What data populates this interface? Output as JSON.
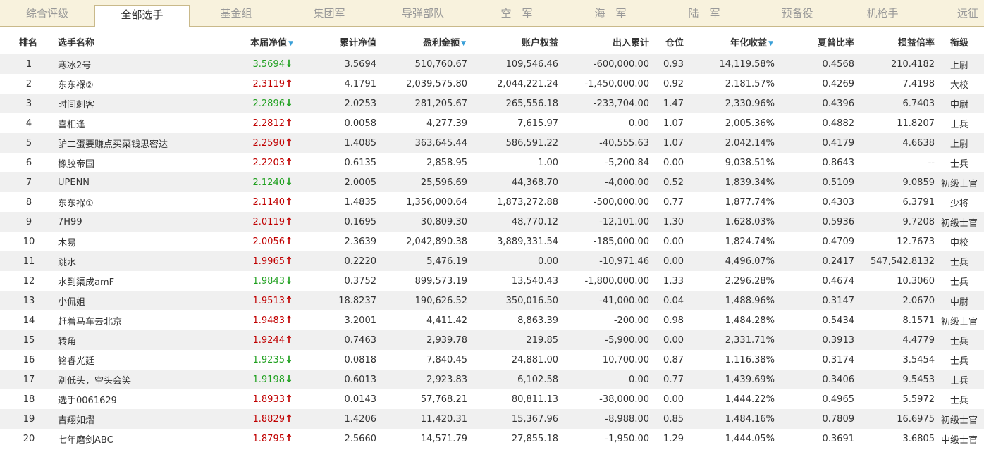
{
  "tabs": [
    {
      "label": "综合评级",
      "active": false
    },
    {
      "label": "全部选手",
      "active": true
    },
    {
      "label": "基金组",
      "active": false
    },
    {
      "label": "集团军",
      "active": false
    },
    {
      "label": "导弹部队",
      "active": false
    },
    {
      "label": "空　军",
      "active": false
    },
    {
      "label": "海　军",
      "active": false
    },
    {
      "label": "陆　军",
      "active": false
    },
    {
      "label": "预备役",
      "active": false
    },
    {
      "label": "机枪手",
      "active": false
    },
    {
      "label": "远征",
      "active": false
    }
  ],
  "table": {
    "headers": {
      "rank": "排名",
      "name": "选手名称",
      "nav": "本届净值",
      "cum_nav": "累计净值",
      "profit": "盈利金额",
      "equity": "账户权益",
      "flow": "出入累计",
      "position": "仓位",
      "annual": "年化收益",
      "sharpe": "夏普比率",
      "plratio": "损益倍率",
      "title": "衔级"
    },
    "sorted_columns": [
      "nav",
      "profit",
      "annual"
    ],
    "sort_icon": "sort-down-triangle-icon",
    "trend_colors": {
      "up": "#c00000",
      "down": "#1fa01f"
    },
    "rows": [
      {
        "rank": "1",
        "name": "寒冰2号",
        "nav": "3.5694",
        "trend": "down",
        "cum_nav": "3.5694",
        "profit": "510,760.67",
        "equity": "109,546.46",
        "flow": "-600,000.00",
        "position": "0.93",
        "annual": "14,119.58%",
        "sharpe": "0.4568",
        "plratio": "210.4182",
        "title": "上尉"
      },
      {
        "rank": "2",
        "name": "东东褓②",
        "nav": "2.3119",
        "trend": "up",
        "cum_nav": "4.1791",
        "profit": "2,039,575.80",
        "equity": "2,044,221.24",
        "flow": "-1,450,000.00",
        "position": "0.92",
        "annual": "2,181.57%",
        "sharpe": "0.4269",
        "plratio": "7.4198",
        "title": "大校"
      },
      {
        "rank": "3",
        "name": "时间刺客",
        "nav": "2.2896",
        "trend": "down",
        "cum_nav": "2.0253",
        "profit": "281,205.67",
        "equity": "265,556.18",
        "flow": "-233,704.00",
        "position": "1.47",
        "annual": "2,330.96%",
        "sharpe": "0.4396",
        "plratio": "6.7403",
        "title": "中尉"
      },
      {
        "rank": "4",
        "name": "喜相逢",
        "nav": "2.2812",
        "trend": "up",
        "cum_nav": "0.0058",
        "profit": "4,277.39",
        "equity": "7,615.97",
        "flow": "0.00",
        "position": "1.07",
        "annual": "2,005.36%",
        "sharpe": "0.4882",
        "plratio": "11.8207",
        "title": "士兵"
      },
      {
        "rank": "5",
        "name": "驴二蛋要赚点买菜钱思密达",
        "nav": "2.2590",
        "trend": "up",
        "cum_nav": "1.4085",
        "profit": "363,645.44",
        "equity": "586,591.22",
        "flow": "-40,555.63",
        "position": "1.07",
        "annual": "2,042.14%",
        "sharpe": "0.4179",
        "plratio": "4.6638",
        "title": "上尉"
      },
      {
        "rank": "6",
        "name": "橡胶帝国",
        "nav": "2.2203",
        "trend": "up",
        "cum_nav": "0.6135",
        "profit": "2,858.95",
        "equity": "1.00",
        "flow": "-5,200.84",
        "position": "0.00",
        "annual": "9,038.51%",
        "sharpe": "0.8643",
        "plratio": "--",
        "title": "士兵"
      },
      {
        "rank": "7",
        "name": "UPENN",
        "nav": "2.1240",
        "trend": "down",
        "cum_nav": "2.0005",
        "profit": "25,596.69",
        "equity": "44,368.70",
        "flow": "-4,000.00",
        "position": "0.52",
        "annual": "1,839.34%",
        "sharpe": "0.5109",
        "plratio": "9.0859",
        "title": "初级士官"
      },
      {
        "rank": "8",
        "name": "东东褓①",
        "nav": "2.1140",
        "trend": "up",
        "cum_nav": "1.4835",
        "profit": "1,356,000.64",
        "equity": "1,873,272.88",
        "flow": "-500,000.00",
        "position": "0.77",
        "annual": "1,877.74%",
        "sharpe": "0.4303",
        "plratio": "6.3791",
        "title": "少将"
      },
      {
        "rank": "9",
        "name": "7H99",
        "nav": "2.0119",
        "trend": "up",
        "cum_nav": "0.1695",
        "profit": "30,809.30",
        "equity": "48,770.12",
        "flow": "-12,101.00",
        "position": "1.30",
        "annual": "1,628.03%",
        "sharpe": "0.5936",
        "plratio": "9.7208",
        "title": "初级士官"
      },
      {
        "rank": "10",
        "name": "木易",
        "nav": "2.0056",
        "trend": "up",
        "cum_nav": "2.3639",
        "profit": "2,042,890.38",
        "equity": "3,889,331.54",
        "flow": "-185,000.00",
        "position": "0.00",
        "annual": "1,824.74%",
        "sharpe": "0.4709",
        "plratio": "12.7673",
        "title": "中校"
      },
      {
        "rank": "11",
        "name": "跳水",
        "nav": "1.9965",
        "trend": "up",
        "cum_nav": "0.2220",
        "profit": "5,476.19",
        "equity": "0.00",
        "flow": "-10,971.46",
        "position": "0.00",
        "annual": "4,496.07%",
        "sharpe": "0.2417",
        "plratio": "547,542.8132",
        "title": "士兵"
      },
      {
        "rank": "12",
        "name": "水到渠成amF",
        "nav": "1.9843",
        "trend": "down",
        "cum_nav": "0.3752",
        "profit": "899,573.19",
        "equity": "13,540.43",
        "flow": "-1,800,000.00",
        "position": "1.33",
        "annual": "2,296.28%",
        "sharpe": "0.4674",
        "plratio": "10.3060",
        "title": "士兵"
      },
      {
        "rank": "13",
        "name": "小侃姐",
        "nav": "1.9513",
        "trend": "up",
        "cum_nav": "18.8237",
        "profit": "190,626.52",
        "equity": "350,016.50",
        "flow": "-41,000.00",
        "position": "0.04",
        "annual": "1,488.96%",
        "sharpe": "0.3147",
        "plratio": "2.0670",
        "title": "中尉"
      },
      {
        "rank": "14",
        "name": "赶着马车去北京",
        "nav": "1.9483",
        "trend": "up",
        "cum_nav": "3.2001",
        "profit": "4,411.42",
        "equity": "8,863.39",
        "flow": "-200.00",
        "position": "0.98",
        "annual": "1,484.28%",
        "sharpe": "0.5434",
        "plratio": "8.1571",
        "title": "初级士官"
      },
      {
        "rank": "15",
        "name": "转角",
        "nav": "1.9244",
        "trend": "up",
        "cum_nav": "0.7463",
        "profit": "2,939.78",
        "equity": "219.85",
        "flow": "-5,900.00",
        "position": "0.00",
        "annual": "2,331.71%",
        "sharpe": "0.3913",
        "plratio": "4.4779",
        "title": "士兵"
      },
      {
        "rank": "16",
        "name": "铭睿光廷",
        "nav": "1.9235",
        "trend": "down",
        "cum_nav": "0.0818",
        "profit": "7,840.45",
        "equity": "24,881.00",
        "flow": "10,700.00",
        "position": "0.87",
        "annual": "1,116.38%",
        "sharpe": "0.3174",
        "plratio": "3.5454",
        "title": "士兵"
      },
      {
        "rank": "17",
        "name": "别低头，空头会笑",
        "nav": "1.9198",
        "trend": "down",
        "cum_nav": "0.6013",
        "profit": "2,923.83",
        "equity": "6,102.58",
        "flow": "0.00",
        "position": "0.77",
        "annual": "1,439.69%",
        "sharpe": "0.3406",
        "plratio": "9.5453",
        "title": "士兵"
      },
      {
        "rank": "18",
        "name": "选手0061629",
        "nav": "1.8933",
        "trend": "up",
        "cum_nav": "0.0143",
        "profit": "57,768.21",
        "equity": "80,811.13",
        "flow": "-38,000.00",
        "position": "0.00",
        "annual": "1,444.22%",
        "sharpe": "0.4965",
        "plratio": "5.5972",
        "title": "士兵"
      },
      {
        "rank": "19",
        "name": "吉翔如熠",
        "nav": "1.8829",
        "trend": "up",
        "cum_nav": "1.4206",
        "profit": "11,420.31",
        "equity": "15,367.96",
        "flow": "-8,988.00",
        "position": "0.85",
        "annual": "1,484.16%",
        "sharpe": "0.7809",
        "plratio": "16.6975",
        "title": "初级士官"
      },
      {
        "rank": "20",
        "name": "七年磨剑ABC",
        "nav": "1.8795",
        "trend": "up",
        "cum_nav": "2.5660",
        "profit": "14,571.79",
        "equity": "27,855.18",
        "flow": "-1,950.00",
        "position": "1.29",
        "annual": "1,444.05%",
        "sharpe": "0.3691",
        "plratio": "3.6805",
        "title": "中级士官"
      }
    ]
  }
}
